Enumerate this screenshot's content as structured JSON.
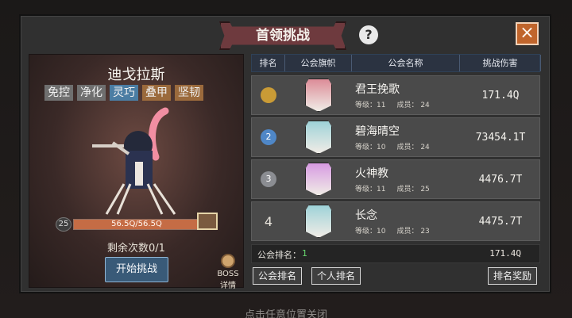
{
  "modal": {
    "title": "首领挑战",
    "help_icon": "question-icon",
    "close_icon": "close-icon"
  },
  "boss": {
    "name": "迪戈拉斯",
    "tags": [
      "免控",
      "净化",
      "灵巧",
      "叠甲",
      "坚韧"
    ],
    "level": "25",
    "hp_text": "56.5Q/56.5Q",
    "hp_fraction": 1.0,
    "remaining_text": "剩余次数0/1",
    "start_button": "开始挑战",
    "detail_top": "BOSS",
    "detail_bottom": "详情",
    "colors": {
      "tag_blue": "#4b7da3",
      "tag_brown": "#9b6a3c"
    }
  },
  "table": {
    "headers": [
      "排名",
      "公会旗帜",
      "公会名称",
      "挑战伤害"
    ],
    "rows": [
      {
        "rank": "1",
        "rank_icon": "gold-medal-icon",
        "name": "君王挽歌",
        "level_label": "等级：11",
        "members_label": "成员： 24",
        "damage": "171.4Q",
        "banner_color": "#dc8c98"
      },
      {
        "rank": "2",
        "rank_icon": "blue-medal-icon",
        "name": "碧海晴空",
        "level_label": "等级：10",
        "members_label": "成员： 24",
        "damage": "73454.1T",
        "banner_color": "#9ed2d8"
      },
      {
        "rank": "3",
        "rank_icon": "silver-medal-icon",
        "name": "火神教",
        "level_label": "等级：11",
        "members_label": "成员： 25",
        "damage": "4476.7T",
        "banner_color": "#d79ae2"
      },
      {
        "rank": "4",
        "rank_icon": "",
        "name": "长念",
        "level_label": "等级：10",
        "members_label": "成员： 23",
        "damage": "4475.7T",
        "banner_color": "#9ed2d8"
      }
    ]
  },
  "my_rank": {
    "label": "公会排名：",
    "value": "1",
    "damage": "171.4Q"
  },
  "buttons": {
    "guild_rank": "公会排名",
    "personal_rank": "个人排名",
    "rank_reward": "排名奖励"
  },
  "footer": {
    "tip": "点击任意位置关闭"
  }
}
